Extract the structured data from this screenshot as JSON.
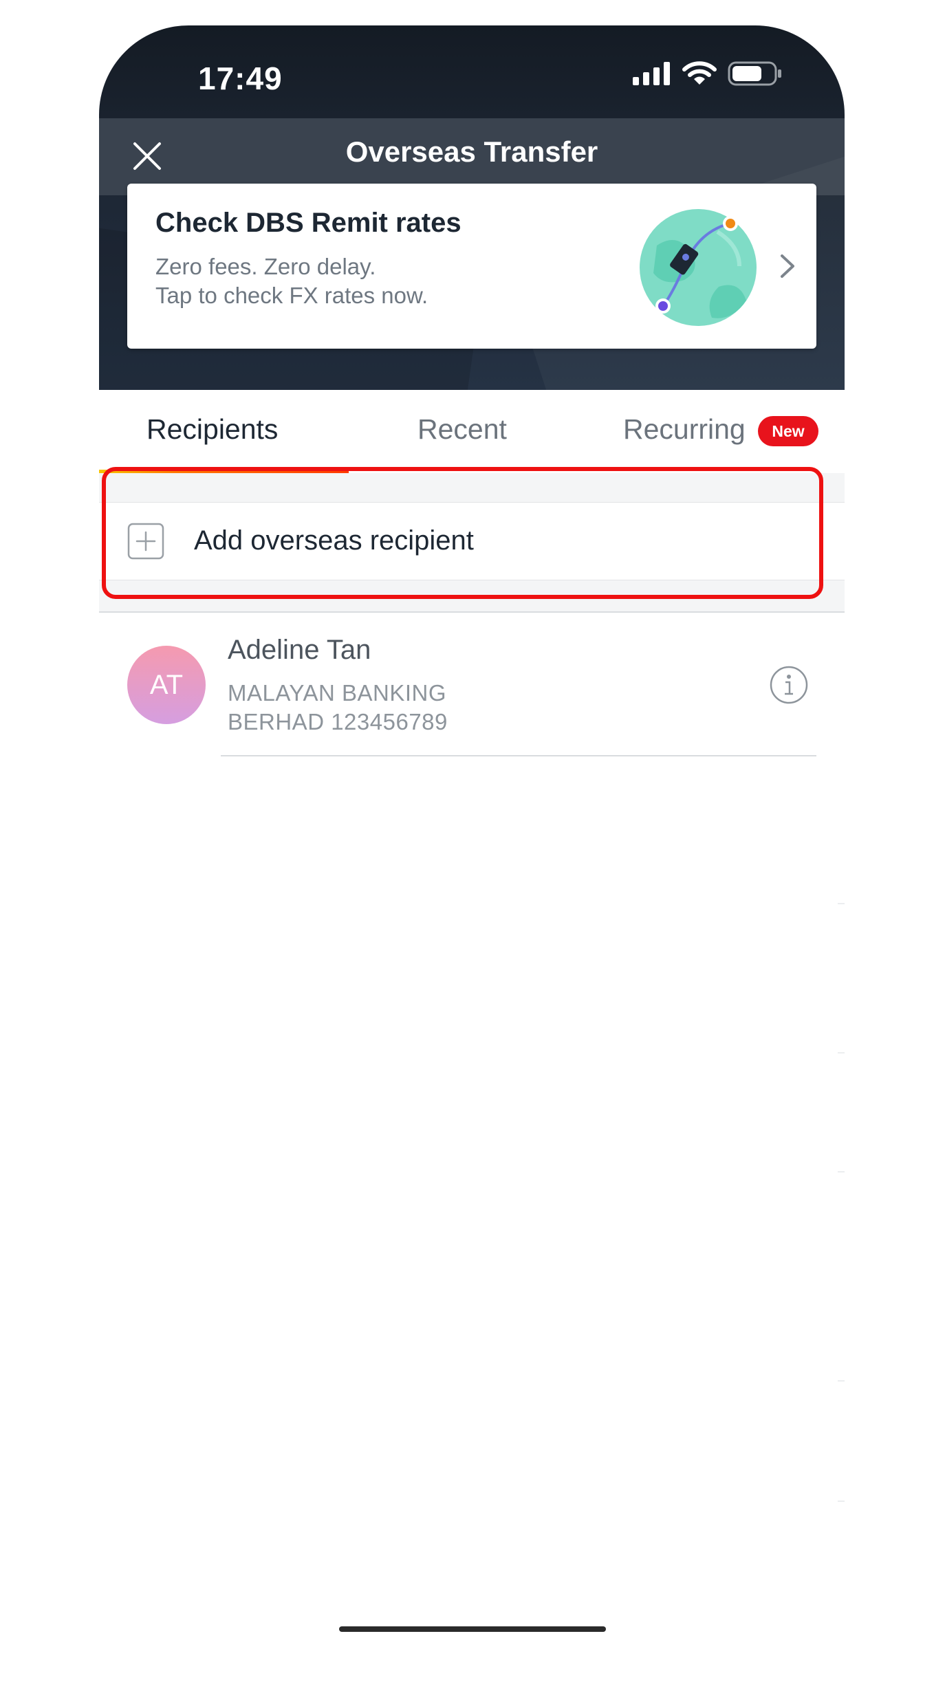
{
  "status_bar": {
    "time": "17:49",
    "icons": [
      "signal-icon",
      "wifi-icon",
      "battery-icon"
    ]
  },
  "header": {
    "title": "Overseas Transfer",
    "close_icon": "close-icon"
  },
  "promo": {
    "title": "Check DBS Remit rates",
    "line1": "Zero fees. Zero delay.",
    "line2": "Tap to check FX rates now.",
    "icon": "chevron-right-icon"
  },
  "tabs": [
    {
      "label": "Recipients",
      "active": true
    },
    {
      "label": "Recent",
      "active": false
    },
    {
      "label": "Recurring",
      "active": false,
      "badge": "New"
    }
  ],
  "add_recipient": {
    "label": "Add overseas recipient",
    "icon": "plus-icon"
  },
  "recipients": [
    {
      "initials": "AT",
      "name": "Adeline Tan",
      "bank_line1": "MALAYAN BANKING",
      "bank_line2": "BERHAD 123456789"
    }
  ],
  "colors": {
    "brand_red": "#e8131c",
    "highlight_red": "#ee1111",
    "hero_dark": "#1c2532",
    "text_dark": "#1d2733",
    "text_muted": "#6e7781"
  }
}
